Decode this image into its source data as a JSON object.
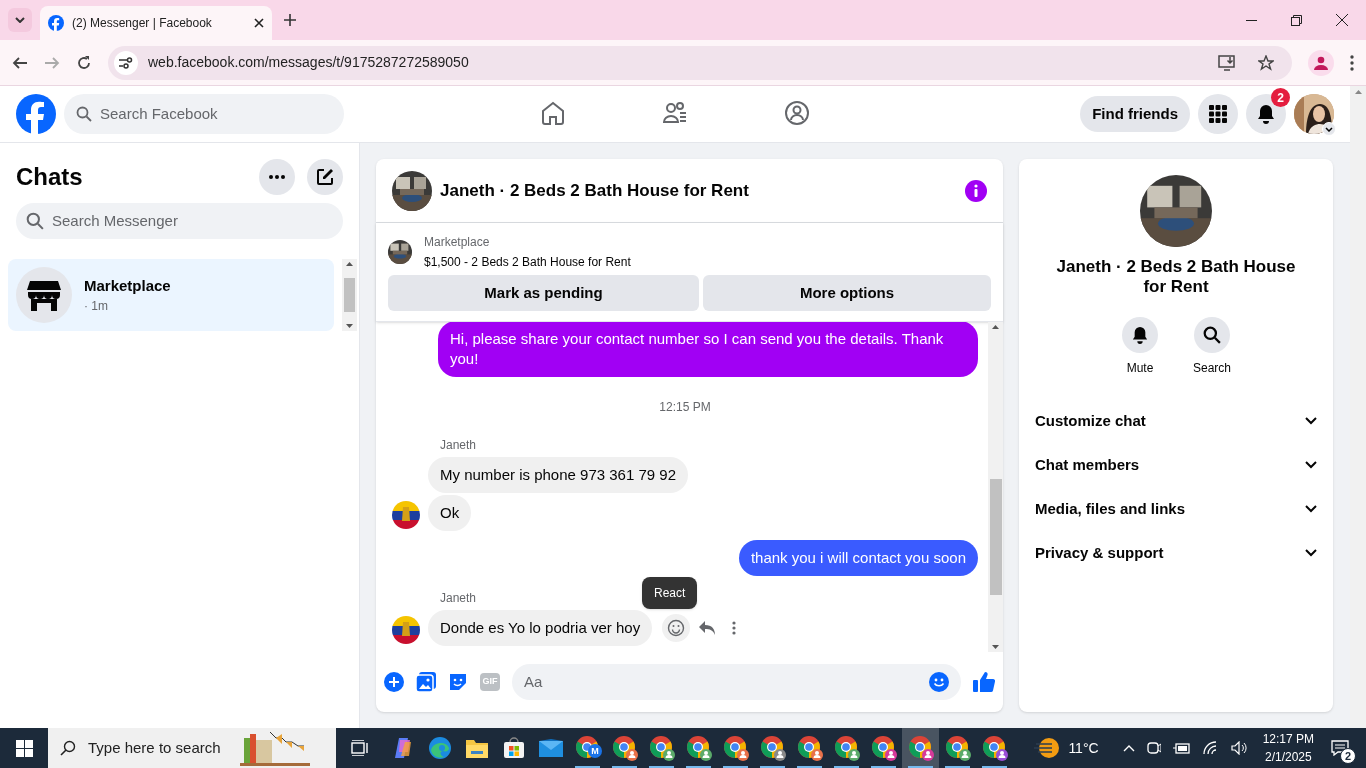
{
  "browser": {
    "tab_title": "(2) Messenger | Facebook",
    "url": "web.facebook.com/messages/t/9175287272589050"
  },
  "header": {
    "search_placeholder": "Search Facebook",
    "find_friends": "Find friends",
    "notification_count": "2"
  },
  "sidebar": {
    "title": "Chats",
    "search_placeholder": "Search Messenger",
    "chats": [
      {
        "name": "Marketplace",
        "time": "· 1m",
        "selected": true
      }
    ]
  },
  "conversation": {
    "title": "Janeth · 2 Beds 2 Bath House for Rent",
    "listing": {
      "source": "Marketplace",
      "summary": "$1,500 - 2 Beds 2 Bath House for Rent"
    },
    "actions": [
      "Mark as pending",
      "More options"
    ],
    "messages": [
      {
        "kind": "outgoing",
        "text": "Hi, please share your contact number so I can send you the details. Thank you!",
        "color": "#a100f4"
      },
      {
        "kind": "timestamp",
        "text": "12:15 PM"
      },
      {
        "kind": "incoming",
        "sender": "Janeth",
        "text": "My number is phone 973 361 79 92",
        "avatar": false
      },
      {
        "kind": "incoming",
        "text": "Ok",
        "avatar": true
      },
      {
        "kind": "outgoing",
        "text": "thank you i will contact you soon",
        "color": "#3a5bff"
      },
      {
        "kind": "incoming",
        "sender": "Janeth",
        "text": "Donde es Yo lo podria ver hoy",
        "avatar": true,
        "hovered": true
      }
    ],
    "tooltip": "React",
    "gif_label": "GIF",
    "composer_placeholder": "Aa"
  },
  "details": {
    "title": "Janeth · 2 Beds 2 Bath House for Rent",
    "buttons": [
      "Mute",
      "Search"
    ],
    "sections": [
      "Customize chat",
      "Chat members",
      "Media, files and links",
      "Privacy & support"
    ]
  },
  "taskbar": {
    "search_placeholder": "Type here to search",
    "weather": "11°C",
    "time": "12:17 PM",
    "date": "2/1/2025",
    "notification_count": "2",
    "chrome_profiles": [
      {
        "color": "#1a73e8",
        "letter": "M",
        "selected": false
      },
      {
        "color": "#e8714a",
        "selected": false
      },
      {
        "color": "#5bab6a",
        "selected": false
      },
      {
        "color": "#5bab6a",
        "selected": false
      },
      {
        "color": "#e8714a",
        "selected": false
      },
      {
        "color": "#8a8a8a",
        "selected": false
      },
      {
        "color": "#e8714a",
        "selected": false
      },
      {
        "color": "#5bab6a",
        "selected": false
      },
      {
        "color": "#d63a9a",
        "selected": false
      },
      {
        "color": "#d63a9a",
        "selected": true
      },
      {
        "color": "#5bab6a",
        "selected": false
      },
      {
        "color": "#9b4fd6",
        "selected": false
      }
    ]
  }
}
